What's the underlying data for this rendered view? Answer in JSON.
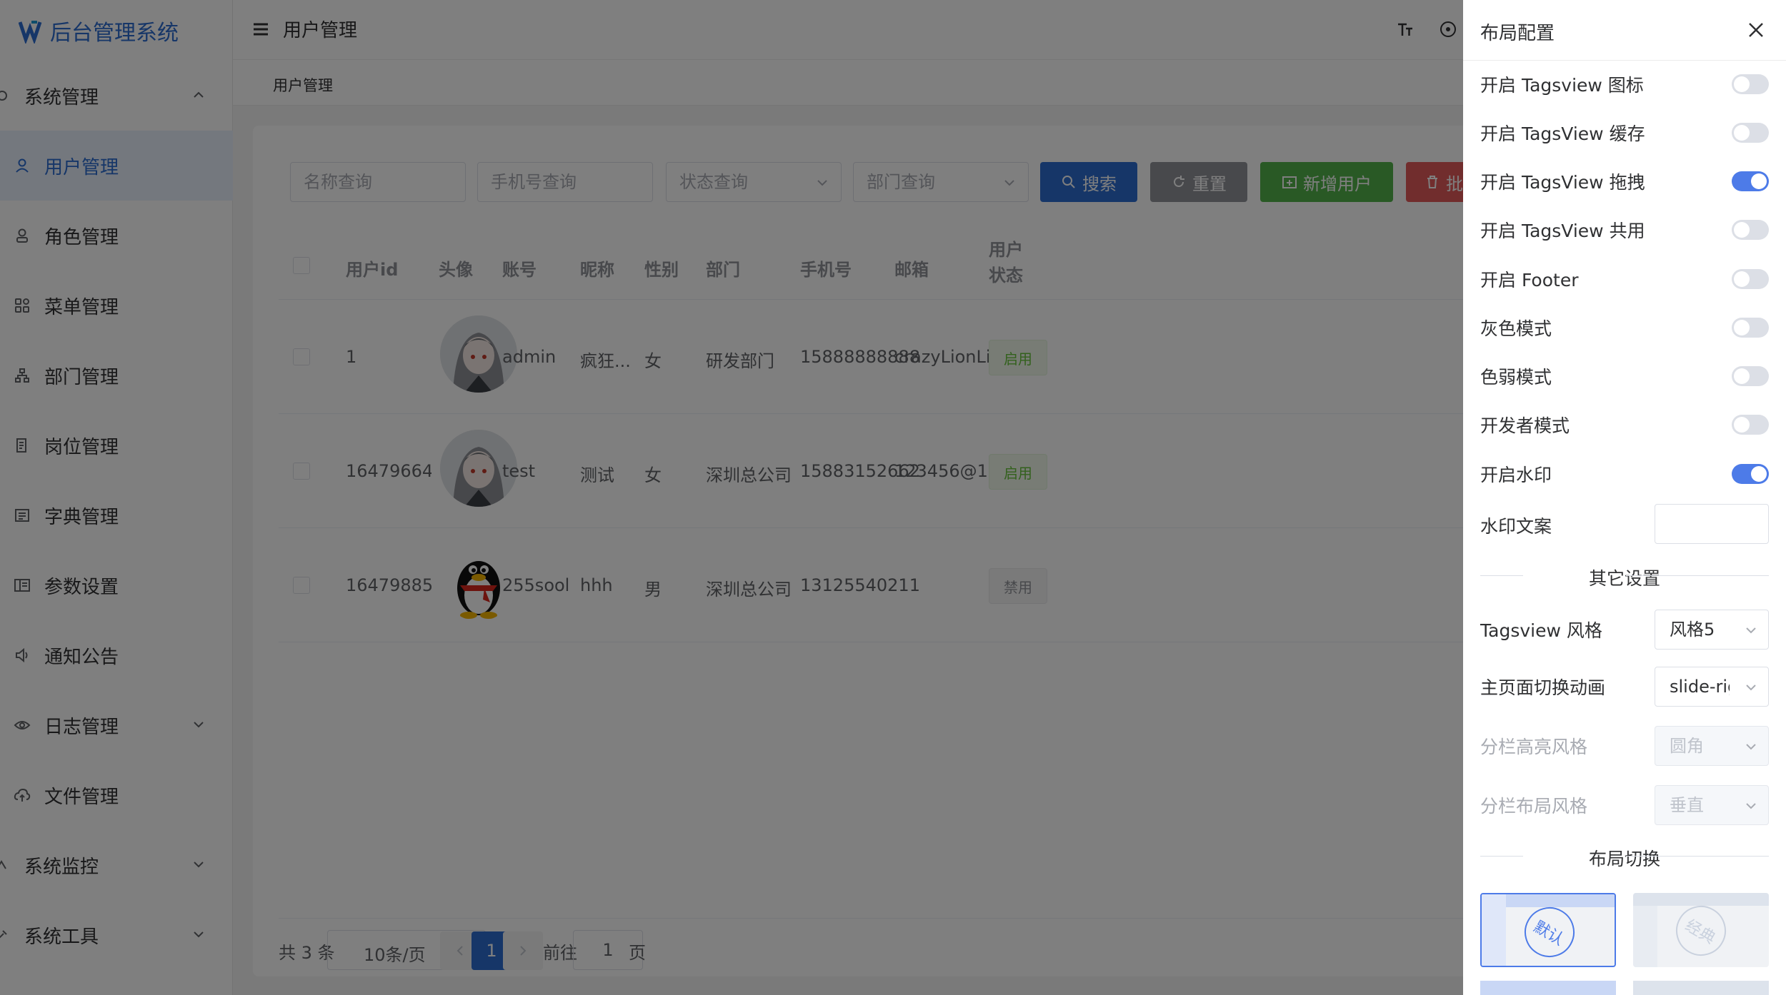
{
  "sidebar": {
    "logo_text": "后台管理系统",
    "items": [
      {
        "label": "系统管理",
        "icon": "gear-icon"
      },
      {
        "label": "用户管理",
        "icon": "user-icon"
      },
      {
        "label": "角色管理",
        "icon": "role-icon"
      },
      {
        "label": "菜单管理",
        "icon": "menu-grid-icon"
      },
      {
        "label": "部门管理",
        "icon": "department-icon"
      },
      {
        "label": "岗位管理",
        "icon": "post-icon"
      },
      {
        "label": "字典管理",
        "icon": "dictionary-icon"
      },
      {
        "label": "参数设置",
        "icon": "settings-icon"
      },
      {
        "label": "通知公告",
        "icon": "speaker-icon"
      },
      {
        "label": "日志管理",
        "icon": "eye-icon"
      },
      {
        "label": "文件管理",
        "icon": "cloud-upload-icon"
      },
      {
        "label": "系统监控",
        "icon": "monitor-icon"
      },
      {
        "label": "系统工具",
        "icon": "tool-icon"
      }
    ]
  },
  "topbar": {
    "title": "用户管理"
  },
  "tags": {
    "active": "用户管理"
  },
  "filters": {
    "name_placeholder": "名称查询",
    "phone_placeholder": "手机号查询",
    "status_placeholder": "状态查询",
    "dept_placeholder": "部门查询"
  },
  "buttons": {
    "search": "搜索",
    "reset": "重置",
    "add_user": "新增用户",
    "batch": "批"
  },
  "table": {
    "headers": [
      "用户id",
      "头像",
      "账号",
      "昵称",
      "性别",
      "部门",
      "手机号",
      "邮箱"
    ],
    "status_header_line1": "用户",
    "status_header_line2": "状态",
    "rows": [
      {
        "id": "1",
        "account": "admin",
        "nickname": "疯狂...",
        "gender": "女",
        "dept": "研发部门",
        "phone": "15888888888",
        "email": "crazyLionLi...",
        "status": "启用"
      },
      {
        "id": "164796642...",
        "account": "test",
        "nickname": "测试",
        "gender": "女",
        "dept": "深圳总公司",
        "phone": "15883152662",
        "email": "123456@1...",
        "status": "启用"
      },
      {
        "id": "164798850...",
        "account": "255sool",
        "nickname": "hhh",
        "gender": "男",
        "dept": "深圳总公司",
        "phone": "13125540211",
        "email": "",
        "status": "禁用"
      }
    ]
  },
  "pagination": {
    "total": "共 3 条",
    "page_size": "10条/页",
    "current": "1",
    "goto_label": "前往",
    "goto_value": "1",
    "page_suffix": "页"
  },
  "drawer": {
    "title": "布局配置",
    "toggles": [
      {
        "label": "开启 Tagsview 图标",
        "on": false
      },
      {
        "label": "开启 TagsView 缓存",
        "on": false
      },
      {
        "label": "开启 TagsView 拖拽",
        "on": true
      },
      {
        "label": "开启 TagsView 共用",
        "on": false
      },
      {
        "label": "开启 Footer",
        "on": false
      },
      {
        "label": "灰色模式",
        "on": false
      },
      {
        "label": "色弱模式",
        "on": false
      },
      {
        "label": "开发者模式",
        "on": false
      },
      {
        "label": "开启水印",
        "on": true
      }
    ],
    "watermark_label": "水印文案",
    "watermark_value": "",
    "other_settings": "其它设置",
    "selects": [
      {
        "label": "Tagsview 风格",
        "value": "风格5",
        "disabled": false
      },
      {
        "label": "主页面切换动画",
        "value": "slide-right",
        "disabled": false
      },
      {
        "label": "分栏高亮风格",
        "value": "圆角",
        "disabled": true
      },
      {
        "label": "分栏布局风格",
        "value": "垂直",
        "disabled": true
      }
    ],
    "layout_switch": "布局切换",
    "layouts": [
      "默认",
      "经典"
    ]
  },
  "colors": {
    "primary": "#2d6cd1",
    "search_btn": "#2d6cd1",
    "reset_btn": "#909399",
    "add_btn": "#52b34a",
    "batch_btn": "#e25a5a",
    "switch_on": "#4d7be8"
  }
}
